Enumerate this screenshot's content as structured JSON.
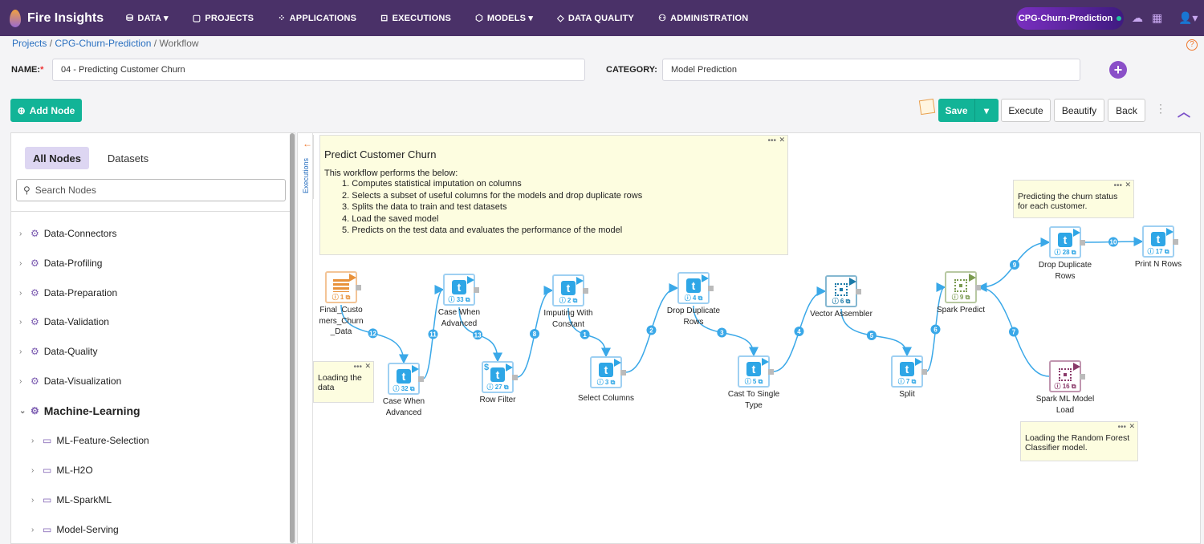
{
  "header": {
    "app_name": "Fire Insights",
    "nav": [
      {
        "label": "DATA",
        "icon": "database-icon",
        "dropdown": true
      },
      {
        "label": "PROJECTS",
        "icon": "folder-icon"
      },
      {
        "label": "APPLICATIONS",
        "icon": "apps-icon"
      },
      {
        "label": "EXECUTIONS",
        "icon": "chart-icon"
      },
      {
        "label": "MODELS",
        "icon": "cube-icon",
        "dropdown": true
      },
      {
        "label": "DATA QUALITY",
        "icon": "diamond-icon"
      },
      {
        "label": "ADMINISTRATION",
        "icon": "user-icon"
      }
    ],
    "project_badge": "CPG-Churn-Prediction"
  },
  "breadcrumb": [
    "Projects",
    "CPG-Churn-Prediction",
    "Workflow"
  ],
  "form": {
    "name_label": "NAME:",
    "required_mark": "*",
    "name_value": "04 - Predicting Customer Churn",
    "category_label": "CATEGORY:",
    "category_value": "Model Prediction"
  },
  "toolbar": {
    "add_node": "Add Node",
    "save": "Save",
    "execute": "Execute",
    "beautify": "Beautify",
    "back": "Back"
  },
  "sidebar": {
    "tabs": [
      "All Nodes",
      "Datasets"
    ],
    "search_placeholder": "Search Nodes",
    "items": [
      {
        "label": "Data-Connectors",
        "level": 0
      },
      {
        "label": "Data-Profiling",
        "level": 0
      },
      {
        "label": "Data-Preparation",
        "level": 0
      },
      {
        "label": "Data-Validation",
        "level": 0
      },
      {
        "label": "Data-Quality",
        "level": 0
      },
      {
        "label": "Data-Visualization",
        "level": 0
      },
      {
        "label": "Machine-Learning",
        "level": 0,
        "expanded": true
      },
      {
        "label": "ML-Feature-Selection",
        "level": 1
      },
      {
        "label": "ML-H2O",
        "level": 1
      },
      {
        "label": "ML-SparkML",
        "level": 1
      },
      {
        "label": "Model-Serving",
        "level": 1
      }
    ]
  },
  "executions_tab": "Executions",
  "notes": {
    "main_title": "Predict Customer Churn",
    "main_intro": "This workflow performs the below:",
    "main_steps": [
      "1. Computes statistical imputation on columns",
      "2. Selects a subset of useful columns for the models and drop duplicate rows",
      "3. Splits the data to train and test datasets",
      "4. Load the saved model",
      "5. Predicts on the test data and evaluates the performance of the model"
    ],
    "loading": "Loading the data",
    "predicting": "Predicting the churn status for each customer.",
    "loading_model": "Loading the Random Forest Classifier model."
  },
  "nodes": [
    {
      "id": "1",
      "label": "Final_Custo mers_Churn _Data",
      "type": "dataset",
      "color": "#e8913a"
    },
    {
      "id": "32",
      "label": "Case When Advanced",
      "type": "transform"
    },
    {
      "id": "33",
      "label": "Case When Advanced",
      "type": "transform"
    },
    {
      "id": "27",
      "label": "Row Filter",
      "type": "transform"
    },
    {
      "id": "2",
      "label": "Imputing With Constant",
      "type": "transform"
    },
    {
      "id": "3",
      "label": "Select Columns",
      "type": "transform"
    },
    {
      "id": "4",
      "label": "Drop Duplicate Rows",
      "type": "transform"
    },
    {
      "id": "5",
      "label": "Cast To Single Type",
      "type": "transform"
    },
    {
      "id": "6",
      "label": "Vector Assembler",
      "type": "ml",
      "color": "#1a7aa8"
    },
    {
      "id": "7",
      "label": "Split",
      "type": "transform"
    },
    {
      "id": "9",
      "label": "Spark Predict",
      "type": "ml",
      "color": "#7a9a50"
    },
    {
      "id": "28",
      "label": "Drop Duplicate Rows",
      "type": "transform"
    },
    {
      "id": "17",
      "label": "Print N Rows",
      "type": "transform"
    },
    {
      "id": "16",
      "label": "Spark ML Model Load",
      "type": "ml",
      "color": "#8a3a6a"
    }
  ],
  "edges": [
    {
      "n": "12",
      "from": "1",
      "to": "32"
    },
    {
      "n": "11",
      "from": "32",
      "to": "33"
    },
    {
      "n": "13",
      "from": "33",
      "to": "27"
    },
    {
      "n": "8",
      "from": "27",
      "to": "2"
    },
    {
      "n": "1",
      "from": "2",
      "to": "3"
    },
    {
      "n": "2",
      "from": "3",
      "to": "4"
    },
    {
      "n": "3",
      "from": "4",
      "to": "5"
    },
    {
      "n": "4",
      "from": "5",
      "to": "6"
    },
    {
      "n": "5",
      "from": "6",
      "to": "7"
    },
    {
      "n": "6",
      "from": "7",
      "to": "9"
    },
    {
      "n": "7",
      "from": "16",
      "to": "9"
    },
    {
      "n": "9",
      "from": "9",
      "to": "28"
    },
    {
      "n": "10",
      "from": "28",
      "to": "17"
    }
  ],
  "colors": {
    "header": "#4a3168",
    "accent": "#12b497",
    "edge": "#3aa8e8"
  }
}
